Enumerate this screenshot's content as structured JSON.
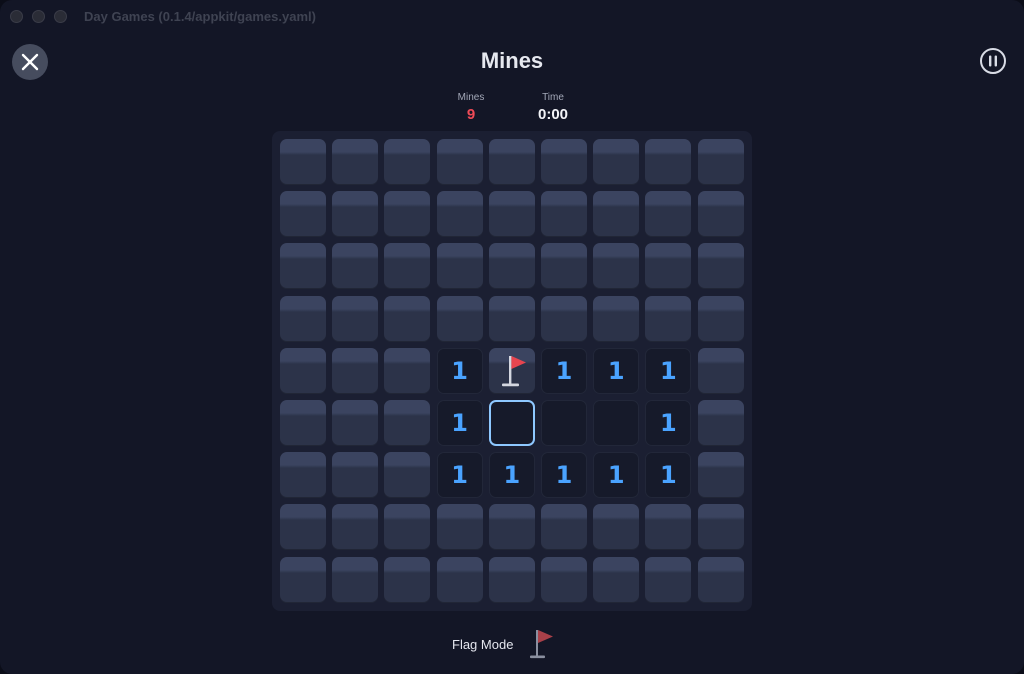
{
  "window": {
    "title": "Day Games (0.1.4/appkit/games.yaml)"
  },
  "header": {
    "title": "Mines",
    "close_icon": "close-icon",
    "pause_icon": "pause-icon"
  },
  "stats": {
    "mines_label": "Mines",
    "mines_value": "9",
    "time_label": "Time",
    "time_value": "0:00"
  },
  "board": {
    "rows": 9,
    "cols": 9,
    "cells": [
      [
        "C",
        "C",
        "C",
        "C",
        "C",
        "C",
        "C",
        "C",
        "C"
      ],
      [
        "C",
        "C",
        "C",
        "C",
        "C",
        "C",
        "C",
        "C",
        "C"
      ],
      [
        "C",
        "C",
        "C",
        "C",
        "C",
        "C",
        "C",
        "C",
        "C"
      ],
      [
        "C",
        "C",
        "C",
        "C",
        "C",
        "C",
        "C",
        "C",
        "C"
      ],
      [
        "C",
        "C",
        "C",
        "1",
        "F",
        "1",
        "1",
        "1",
        "C"
      ],
      [
        "C",
        "C",
        "C",
        "1",
        "S",
        "0",
        "0",
        "1",
        "C"
      ],
      [
        "C",
        "C",
        "C",
        "1",
        "1",
        "1",
        "1",
        "1",
        "C"
      ],
      [
        "C",
        "C",
        "C",
        "C",
        "C",
        "C",
        "C",
        "C",
        "C"
      ],
      [
        "C",
        "C",
        "C",
        "C",
        "C",
        "C",
        "C",
        "C",
        "C"
      ]
    ],
    "number_color": "#4aa3ff"
  },
  "footer": {
    "flag_mode_label": "Flag Mode",
    "flag_icon": "flag-icon"
  },
  "colors": {
    "mines_accent": "#ef4b57",
    "flag_red": "#e8454f",
    "selection": "#8ec8ff"
  }
}
